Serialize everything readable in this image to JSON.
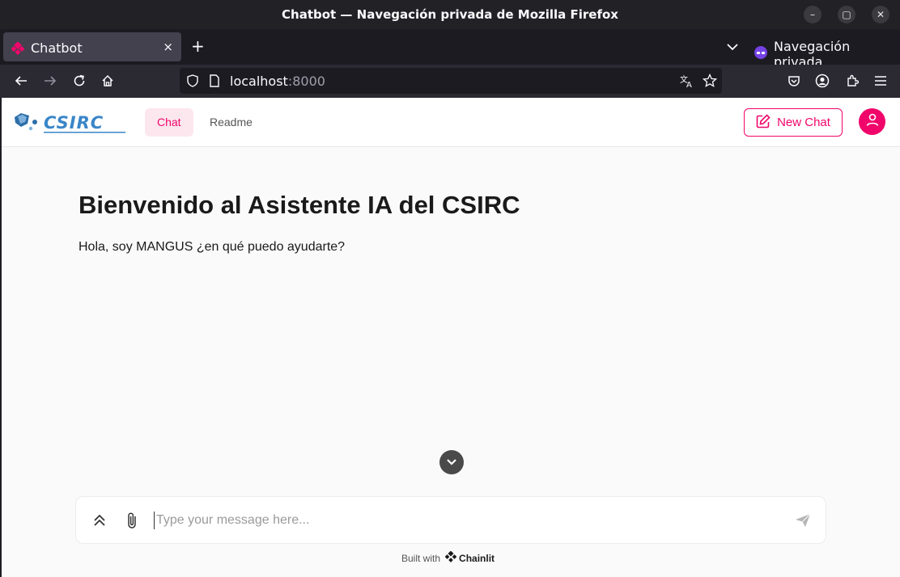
{
  "window": {
    "title": "Chatbot — Navegación privada de Mozilla Firefox",
    "minimize_icon": "minimize-icon",
    "maximize_icon": "maximize-icon",
    "close_icon": "close-icon"
  },
  "tabs": [
    {
      "label": "Chatbot",
      "favicon": "chainlit-favicon-icon",
      "close_label": "×"
    }
  ],
  "tabstrip": {
    "new_tab_label": "+",
    "private_label": "Navegación privada"
  },
  "navbar": {
    "url_host": "localhost",
    "url_port": ":8000"
  },
  "app": {
    "accent_color": "#f0066a",
    "nav": [
      {
        "label": "Chat"
      },
      {
        "label": "Readme"
      }
    ],
    "new_chat_label": "New Chat"
  },
  "welcome": {
    "title": "Bienvenido al Asistente IA del CSIRC",
    "text": "Hola, soy MANGUS ¿en qué puedo ayudarte?"
  },
  "composer": {
    "placeholder": "Type your message here..."
  },
  "footer": {
    "built_with": "Built with",
    "brand": "Chainlit"
  }
}
